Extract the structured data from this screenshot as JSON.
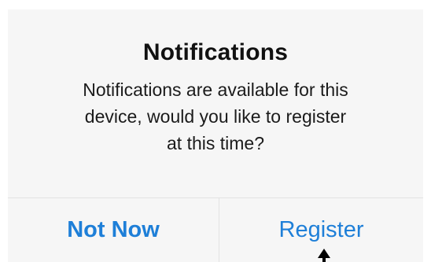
{
  "dialog": {
    "title": "Notifications",
    "message_lines": [
      "Notifications are available for this",
      "device, would you like to register",
      "at this time?"
    ],
    "buttons": {
      "cancel_label": "Not Now",
      "confirm_label": "Register"
    }
  },
  "colors": {
    "dialog_background": "#f6f6f6",
    "button_text": "#1e7fd8",
    "divider": "#e3e3e3"
  },
  "icons": {
    "cursor": "mouse-pointer-icon"
  }
}
